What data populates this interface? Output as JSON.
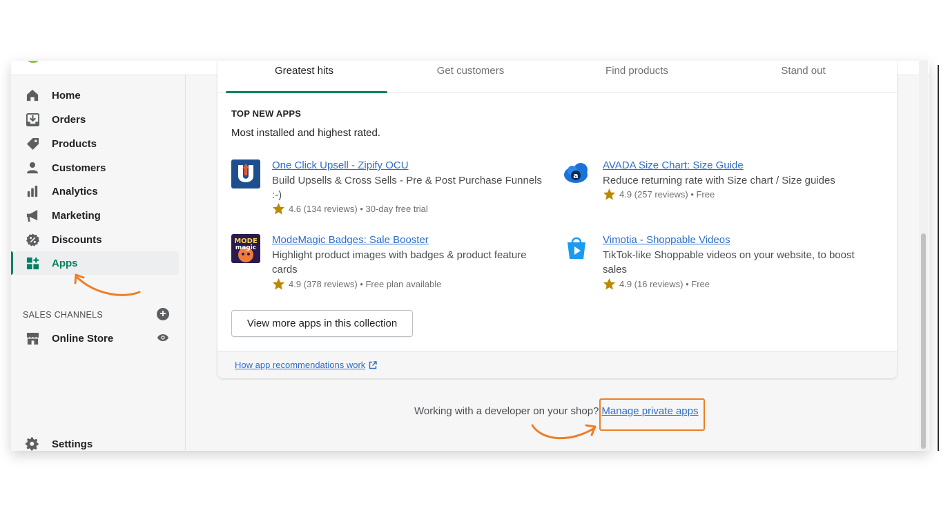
{
  "nav": {
    "items": [
      {
        "label": "Home",
        "icon": "home-icon"
      },
      {
        "label": "Orders",
        "icon": "orders-icon"
      },
      {
        "label": "Products",
        "icon": "tag-icon"
      },
      {
        "label": "Customers",
        "icon": "person-icon"
      },
      {
        "label": "Analytics",
        "icon": "bar-chart-icon"
      },
      {
        "label": "Marketing",
        "icon": "megaphone-icon"
      },
      {
        "label": "Discounts",
        "icon": "discount-icon"
      },
      {
        "label": "Apps",
        "icon": "apps-icon"
      }
    ],
    "sales_channels_label": "SALES CHANNELS",
    "online_store": "Online Store",
    "settings": "Settings"
  },
  "tabs": [
    "Greatest hits",
    "Get customers",
    "Find products",
    "Stand out"
  ],
  "collection": {
    "title": "TOP NEW APPS",
    "subtitle": "Most installed and highest rated.",
    "apps": [
      {
        "name": "One Click Upsell - Zipify OCU",
        "description": "Build Upsells & Cross Sells - Pre & Post Purchase Funnels :-)",
        "rating": "4.6 (134 reviews) • 30-day free trial"
      },
      {
        "name": "AVADA Size Chart: Size Guide",
        "description": "Reduce returning rate with Size chart / Size guides",
        "rating": "4.9 (257 reviews) • Free"
      },
      {
        "name": "ModeMagic Badges: Sale Booster",
        "description": "Highlight product images with badges & product feature cards",
        "rating": "4.9 (378 reviews) • Free plan available"
      },
      {
        "name": "Vimotia - Shoppable Videos",
        "description": "TikTok-like Shoppable videos on your website, to boost sales",
        "rating": "4.9 (16 reviews) • Free"
      }
    ],
    "view_more": "View more apps in this collection",
    "how_link": "How app recommendations work"
  },
  "footer": {
    "working_text": "Working with a developer on your shop?",
    "manage_link": "Manage private apps"
  },
  "colors": {
    "accent": "#008060",
    "link": "#2c6ecb",
    "annotation": "#ec7f25"
  }
}
